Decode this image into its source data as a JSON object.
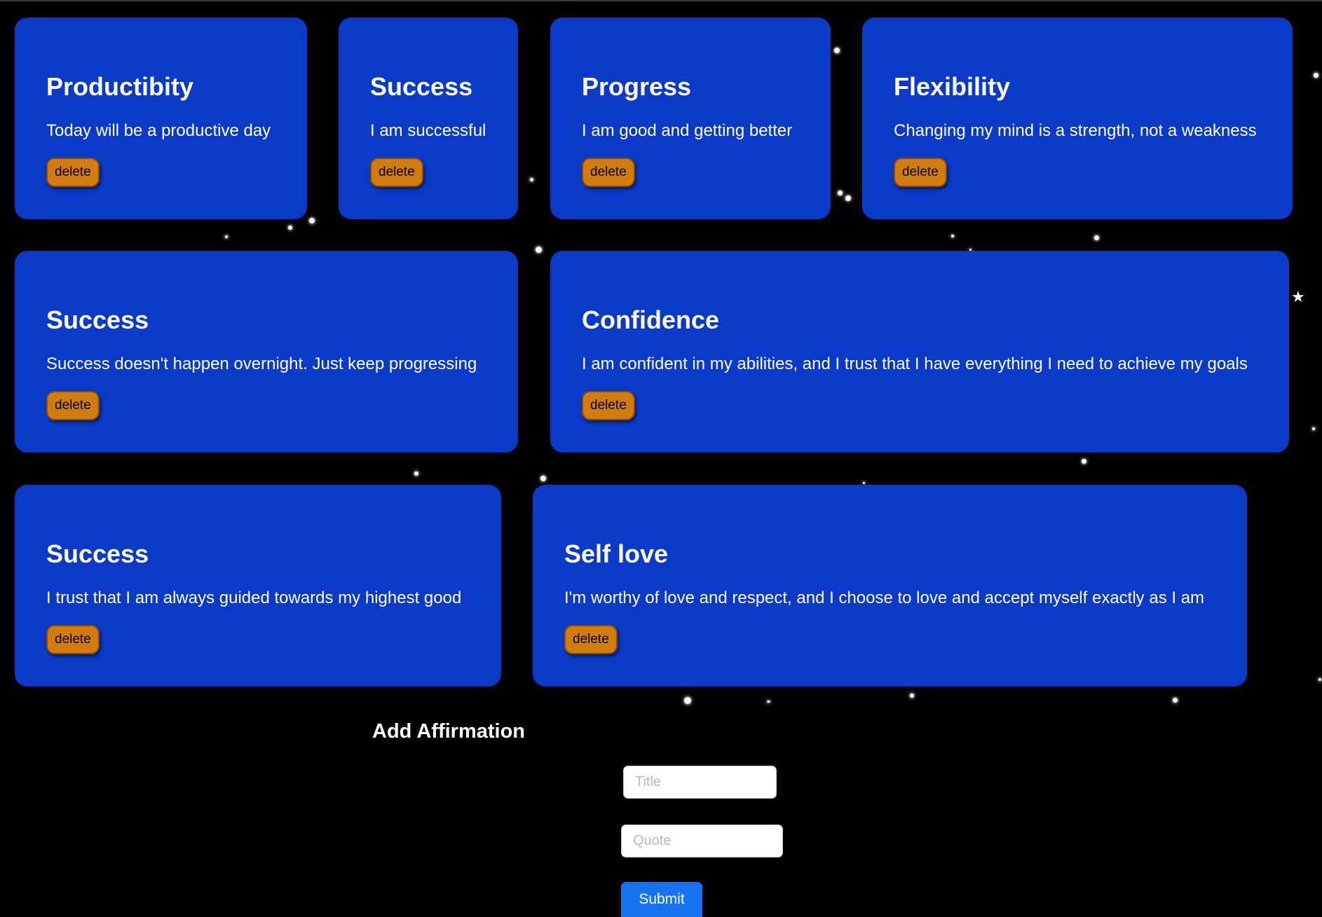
{
  "affirmations": [
    {
      "title": "Productibity",
      "quote": "Today will be a productive day",
      "delete_label": "delete"
    },
    {
      "title": "Success",
      "quote": "I am successful",
      "delete_label": "delete"
    },
    {
      "title": "Progress",
      "quote": "I am good and getting better",
      "delete_label": "delete"
    },
    {
      "title": "Flexibility",
      "quote": "Changing my mind is a strength, not a weakness",
      "delete_label": "delete"
    },
    {
      "title": "Success",
      "quote": "Success doesn't happen overnight. Just keep progressing",
      "delete_label": "delete"
    },
    {
      "title": "Confidence",
      "quote": "I am confident in my abilities, and I trust that I have everything I need to achieve my goals",
      "delete_label": "delete"
    },
    {
      "title": "Success",
      "quote": "I trust that I am always guided towards my highest good",
      "delete_label": "delete"
    },
    {
      "title": "Self love",
      "quote": "I'm worthy of love and respect, and I choose to love and accept myself exactly as I am",
      "delete_label": "delete"
    }
  ],
  "form": {
    "heading": "Add Affirmation",
    "title_placeholder": "Title",
    "title_value": "",
    "quote_placeholder": "Quote",
    "quote_value": "",
    "submit_label": "Submit"
  },
  "colors": {
    "background": "#000000",
    "card": "#0b3ac8",
    "delete_button": "#d27b0e",
    "submit_button": "#1673f2"
  }
}
